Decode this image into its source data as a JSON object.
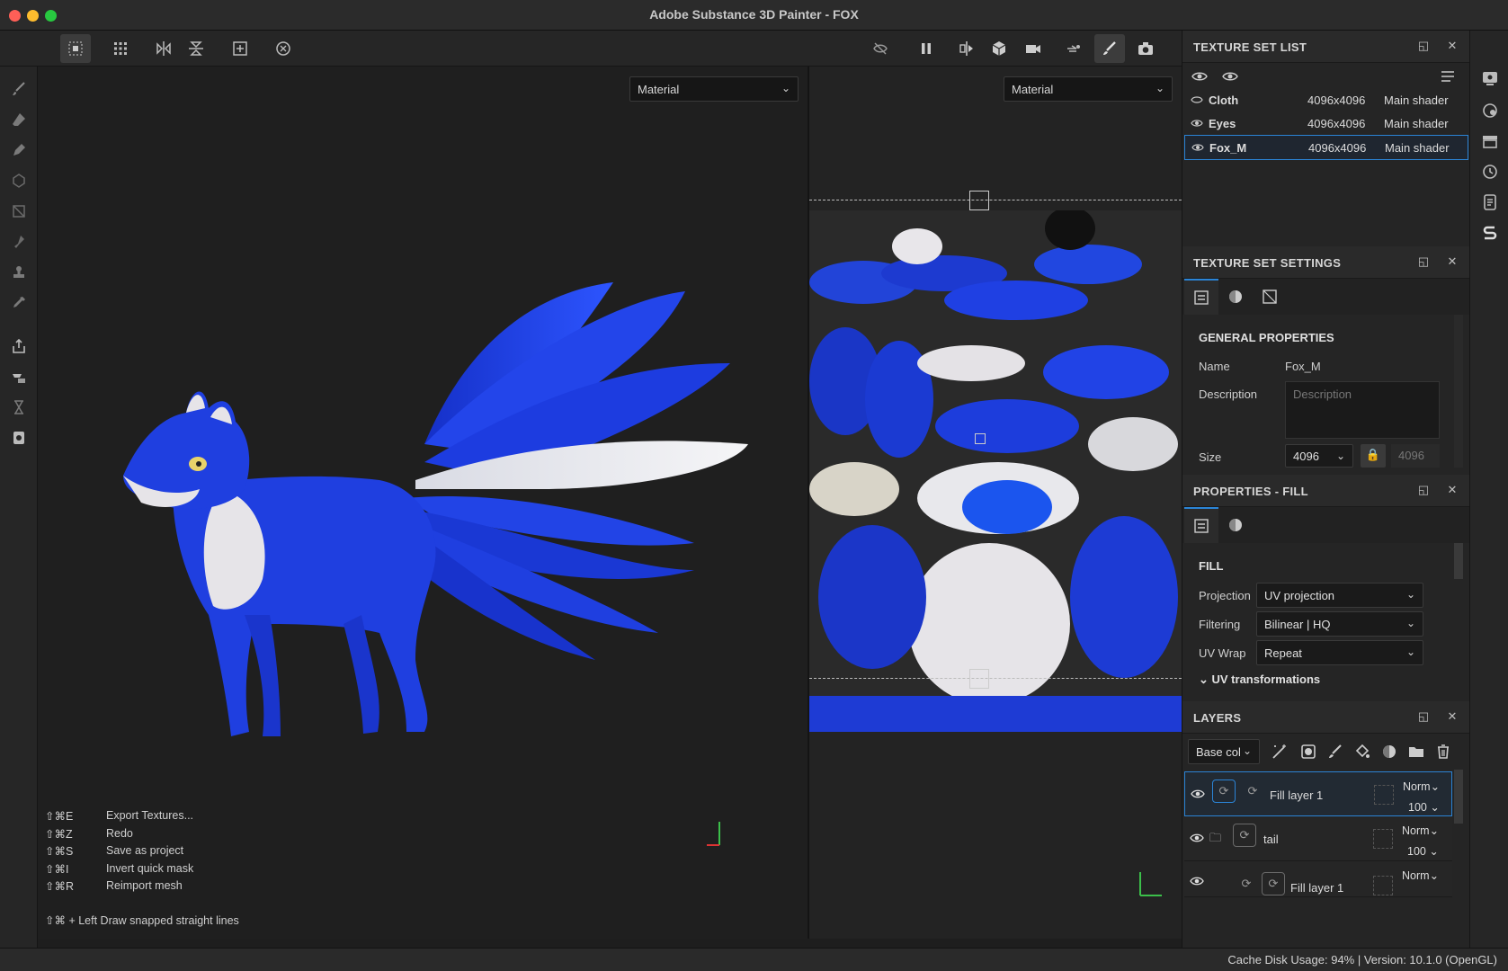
{
  "window": {
    "title": "Adobe Substance 3D Painter - FOX",
    "traffic_lights": [
      "#ff5f57",
      "#febc2e",
      "#28c840"
    ]
  },
  "viewport3d": {
    "channel": "Material",
    "shortcuts": [
      {
        "key": "⇧⌘E",
        "action": "Export Textures..."
      },
      {
        "key": "⇧⌘Z",
        "action": "Redo"
      },
      {
        "key": "⇧⌘S",
        "action": "Save as project"
      },
      {
        "key": "⇧⌘I",
        "action": "Invert quick mask"
      },
      {
        "key": "⇧⌘R",
        "action": "Reimport mesh"
      }
    ],
    "hint": "⇧⌘ + Left  Draw snapped straight lines"
  },
  "viewport2d": {
    "channel": "Material"
  },
  "texture_set_list": {
    "title": "TEXTURE SET LIST",
    "rows": [
      {
        "name": "Cloth",
        "size": "4096x4096",
        "shader": "Main shader"
      },
      {
        "name": "Eyes",
        "size": "4096x4096",
        "shader": "Main shader"
      },
      {
        "name": "Fox_M",
        "size": "4096x4096",
        "shader": "Main shader"
      }
    ]
  },
  "texture_set_settings": {
    "title": "TEXTURE SET SETTINGS",
    "section": "GENERAL PROPERTIES",
    "name_label": "Name",
    "name_value": "Fox_M",
    "description_label": "Description",
    "description_placeholder": "Description",
    "size_label": "Size",
    "size_value": "4096",
    "size_linked": "4096"
  },
  "properties_fill": {
    "title": "PROPERTIES - FILL",
    "section": "FILL",
    "projection_label": "Projection",
    "projection_value": "UV projection",
    "filtering_label": "Filtering",
    "filtering_value": "Bilinear | HQ",
    "uvwrap_label": "UV Wrap",
    "uvwrap_value": "Repeat",
    "uv_transformations": "UV transformations"
  },
  "layers": {
    "title": "LAYERS",
    "channel": "Base col",
    "items": [
      {
        "name": "Fill layer 1",
        "blend": "Norm",
        "opacity": "100"
      },
      {
        "name": "tail",
        "blend": "Norm",
        "opacity": "100"
      },
      {
        "name": "Fill layer 1",
        "blend": "Norm",
        "opacity": ""
      }
    ]
  },
  "status": {
    "text": "Cache Disk Usage:    94% | Version: 10.1.0 (OpenGL)"
  },
  "colors": {
    "accent": "#2b84d6",
    "fox_blue": "#1f3fe0",
    "fox_white": "#e6e4e8"
  }
}
